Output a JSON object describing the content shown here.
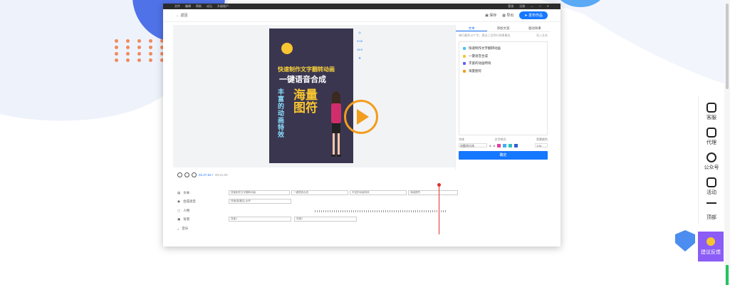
{
  "menu": {
    "items": [
      "文件",
      "编辑",
      "帮助",
      "论坛",
      "升级账户"
    ],
    "right": [
      "登录",
      "注册"
    ],
    "window_controls": [
      "—",
      "□",
      "✕"
    ]
  },
  "toolbar": {
    "back_label": "返回",
    "save_label": "保存",
    "export_label": "导出",
    "publish_label": "发布作品"
  },
  "video": {
    "line1": "快速制作文字翻转动画",
    "line2": "一键语音合成",
    "line3": "海量图符",
    "vertical": "丰富的动画特效"
  },
  "side_tools": [
    "◎",
    "9:16",
    "16:9",
    "⚙"
  ],
  "panel": {
    "tabs": [
      "文本",
      "添加文案",
      "驱动效果"
    ],
    "hint": "每行最多15个字，建议三至四行效果最佳",
    "import_label": "导入文本",
    "lines": [
      {
        "text": "快速制作文字翻转动画",
        "color": "#43c3f0"
      },
      {
        "text": "一键语音合成",
        "color": "#f7c530"
      },
      {
        "text": "丰富的动画特效",
        "color": "#6b5cf6"
      },
      {
        "text": "海量图符",
        "color": "#f29d1c"
      }
    ],
    "font_label": "字体",
    "font_style_label": "文字样式",
    "bg_label": "背景颜色",
    "font_value": "站酷快乐体",
    "size_value": "1.6x",
    "confirm_label": "确定",
    "colors": [
      "#e0409a",
      "#3fb0f0",
      "#30c0c0",
      "#3060d0"
    ]
  },
  "timeline": {
    "current_time": "01:27.52 /",
    "total_time": "00:21.00",
    "tracks": [
      {
        "name": "文本"
      },
      {
        "name": "合成语音"
      },
      {
        "name": "人物"
      },
      {
        "name": "背景"
      },
      {
        "name": "音乐"
      }
    ],
    "clips": {
      "text": [
        "快速制作文字翻转动画",
        "一键语音合成",
        "丰富的动画特效",
        "海量图符"
      ],
      "voice": "快速(普通话) 女声",
      "bg": [
        "背景1",
        "背景2"
      ]
    }
  },
  "floating": {
    "items": [
      "客服",
      "代理",
      "公众号",
      "活动",
      "顶部"
    ],
    "feedback": "建议反馈"
  }
}
